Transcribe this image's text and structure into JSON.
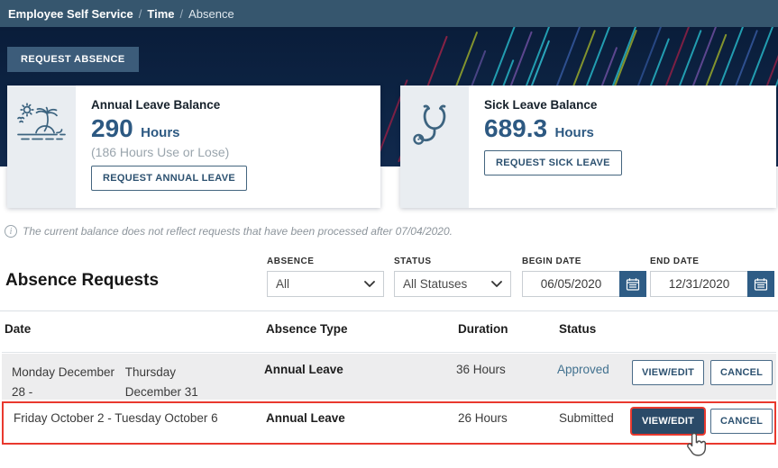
{
  "breadcrumb": {
    "separator": "/",
    "items": [
      {
        "label": "Employee Self Service"
      },
      {
        "label": "Time"
      },
      {
        "label": "Absence"
      }
    ]
  },
  "actions": {
    "request_absence": "REQUEST ABSENCE"
  },
  "cards": {
    "annual": {
      "title": "Annual Leave Balance",
      "value": "290",
      "unit": "Hours",
      "note": "(186 Hours Use or Lose)",
      "button": "REQUEST ANNUAL LEAVE",
      "icon": "island-palm-icon"
    },
    "sick": {
      "title": "Sick Leave Balance",
      "value": "689.3",
      "unit": "Hours",
      "button": "REQUEST SICK LEAVE",
      "icon": "stethoscope-icon"
    }
  },
  "notice": {
    "icon": "info-icon",
    "text": "The current balance does not reflect requests that have been processed after 07/04/2020."
  },
  "requests": {
    "heading": "Absence Requests",
    "filters": {
      "absence": {
        "label": "ABSENCE",
        "value": "All"
      },
      "status": {
        "label": "STATUS",
        "value": "All Statuses"
      },
      "begin_date": {
        "label": "BEGIN DATE",
        "value": "06/05/2020"
      },
      "end_date": {
        "label": "END DATE",
        "value": "12/31/2020"
      }
    },
    "columns": {
      "date": "Date",
      "type": "Absence Type",
      "duration": "Duration",
      "status": "Status"
    },
    "rows": [
      {
        "date_start": "Monday December 28 -",
        "date_end": "Thursday December 31",
        "type": "Annual Leave",
        "duration": "36 Hours",
        "status": "Approved",
        "view_edit": "VIEW/EDIT",
        "cancel": "CANCEL",
        "highlighted": false
      },
      {
        "date": "Friday October 2 - Tuesday October 6",
        "type": "Annual Leave",
        "duration": "26 Hours",
        "status": "Submitted",
        "view_edit": "VIEW/EDIT",
        "cancel": "CANCEL",
        "highlighted": true
      }
    ]
  },
  "colors": {
    "breadcrumb_bar": "#36566e",
    "hero_navy": "#0d2444",
    "accent_navy": "#2b4a68",
    "steel_blue_icon": "#3d6480",
    "approved_status": "#41718f",
    "calendar_button": "#2e5c85",
    "highlight_red": "#e9392e",
    "row_gray": "#ededee"
  }
}
